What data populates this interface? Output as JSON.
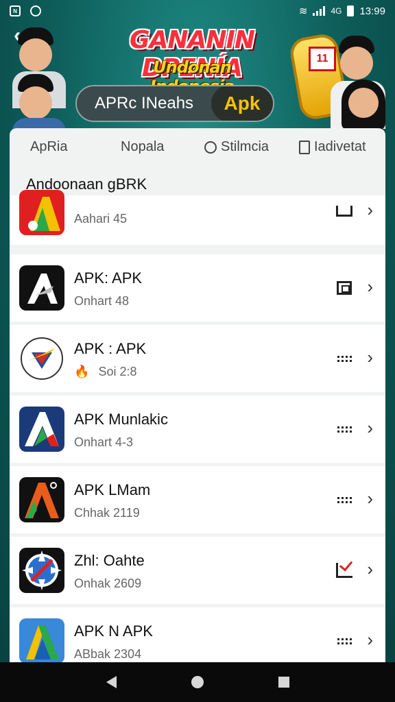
{
  "status_bar": {
    "left_icon_text": "N",
    "time": "13:99"
  },
  "banner": {
    "title": "GANANIN DPENÍA",
    "subtitle": "Undonan Indonesia",
    "pill_left": "APRc INeahs",
    "pill_right": "Apk",
    "slot_text": "11"
  },
  "tabs": [
    {
      "label": "ApRia",
      "icon": "none"
    },
    {
      "label": "Nopala",
      "icon": "none"
    },
    {
      "label": "Stilmcia",
      "icon": "circle-icon"
    },
    {
      "label": "Iadivetat",
      "icon": "square-icon"
    }
  ],
  "section_title": "Andoonaan gBRK",
  "apps": [
    {
      "name": "",
      "sub": "Aahari  45",
      "action": "bag-icon",
      "icon_colors": [
        "#e02020",
        "#2aa84a",
        "#f2c100"
      ]
    },
    {
      "name": "APK: APK",
      "sub": "Onhart  48",
      "action": "square-icon",
      "icon_colors": [
        "#111111",
        "#ffffff"
      ]
    },
    {
      "name": "APK : APK",
      "sub": "Soi  2:8",
      "action": "dots-icon",
      "badge": "🔥",
      "icon_colors": [
        "#ffffff",
        "#c8302a",
        "#1f4e9a"
      ]
    },
    {
      "name": "APK Munlakic",
      "sub": "Onhart  4-3",
      "action": "dots-icon",
      "icon_colors": [
        "#1a3a7a",
        "#e02020",
        "#2aa84a"
      ]
    },
    {
      "name": "APK LMam",
      "sub": "Chhak  2119",
      "action": "dots-icon",
      "icon_colors": [
        "#111111",
        "#e85d1a",
        "#2aa84a"
      ]
    },
    {
      "name": "Zhl: Oahte",
      "sub": "Onhak  2609",
      "action": "check-icon",
      "icon_colors": [
        "#111111",
        "#2a6fd0",
        "#e02020"
      ]
    },
    {
      "name": "APK N APK",
      "sub": "ABbak  2304",
      "action": "dots-icon",
      "icon_colors": [
        "#3a88d8",
        "#f2c100",
        "#2aa84a"
      ]
    }
  ]
}
